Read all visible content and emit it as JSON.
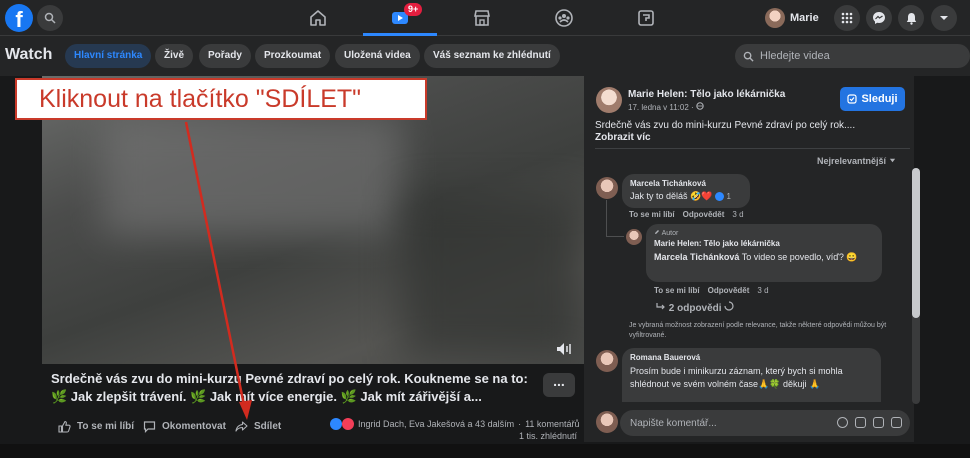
{
  "topnav": {
    "logo": "f",
    "watch_badge": "9+",
    "user_name": "Marie"
  },
  "subnav": {
    "title": "Watch",
    "tabs": [
      {
        "label": "Hlavní stránka",
        "active": true
      },
      {
        "label": "Živě"
      },
      {
        "label": "Pořady"
      },
      {
        "label": "Prozkoumat"
      },
      {
        "label": "Uložená videa"
      },
      {
        "label": "Váš seznam ke zhlédnutí"
      }
    ],
    "search_placeholder": "Hledejte videa"
  },
  "annotation": {
    "callout": "Kliknout na tlačítko \"SDÍLET\""
  },
  "video": {
    "description": "Srdečně vás zvu do mini-kurzu Pevné zdraví po celý rok. Koukneme se na to: 🌿 Jak zlepšit trávení. 🌿 Jak mít více energie. 🌿 Jak mít zářivější a...",
    "more_label": "...",
    "actions": {
      "like": "To se mi líbí",
      "comment": "Okomentovat",
      "share": "Sdílet"
    },
    "reactions_text": "Ingrid Dach, Eva Jakešová a 43 dalším",
    "comments_count": "11 komentářů",
    "views": "1 tis. zhlédnutí"
  },
  "sidebar": {
    "post_author": "Marie Helen: Tělo jako lékárnička",
    "post_date": "17. ledna v 11:02 · ",
    "follow_label": "Sleduji",
    "post_text": "Srdečně vás zvu do mini-kurzu Pevné zdraví po celý rok....",
    "see_more": "Zobrazit víc",
    "sort_label": "Nejrelevantnější",
    "comments": [
      {
        "author": "Marcela Tichánková",
        "text": "Jak ty to děláš 🤣❤️",
        "reaction_count": "1",
        "like": "To se mi líbí",
        "reply": "Odpovědět",
        "time": "3 d"
      },
      {
        "badge": "Autor",
        "author": "Marie Helen: Tělo jako lékárnička",
        "mention": "Marcela Tichánková",
        "text": " To video se povedlo, víď? 😀",
        "like": "To se mi líbí",
        "reply": "Odpovědět",
        "time": "3 d"
      }
    ],
    "replies_link": "2 odpovědi",
    "relevance_note": "Je vybraná možnost zobrazení podle relevance, takže některé odpovědi můžou být vyfiltrované.",
    "third_comment": {
      "author": "Romana Bauerová",
      "text": "Prosím bude i minikurzu záznam, který bych si mohla shlédnout ve svém volném čase🙏🍀 děkuji 🙏"
    },
    "comment_placeholder": "Napište komentář..."
  },
  "colors": {
    "accent": "#2d88ff",
    "follow_button": "#2374e1",
    "callout_red": "#c93a2a",
    "badge_red": "#e41e3f"
  }
}
